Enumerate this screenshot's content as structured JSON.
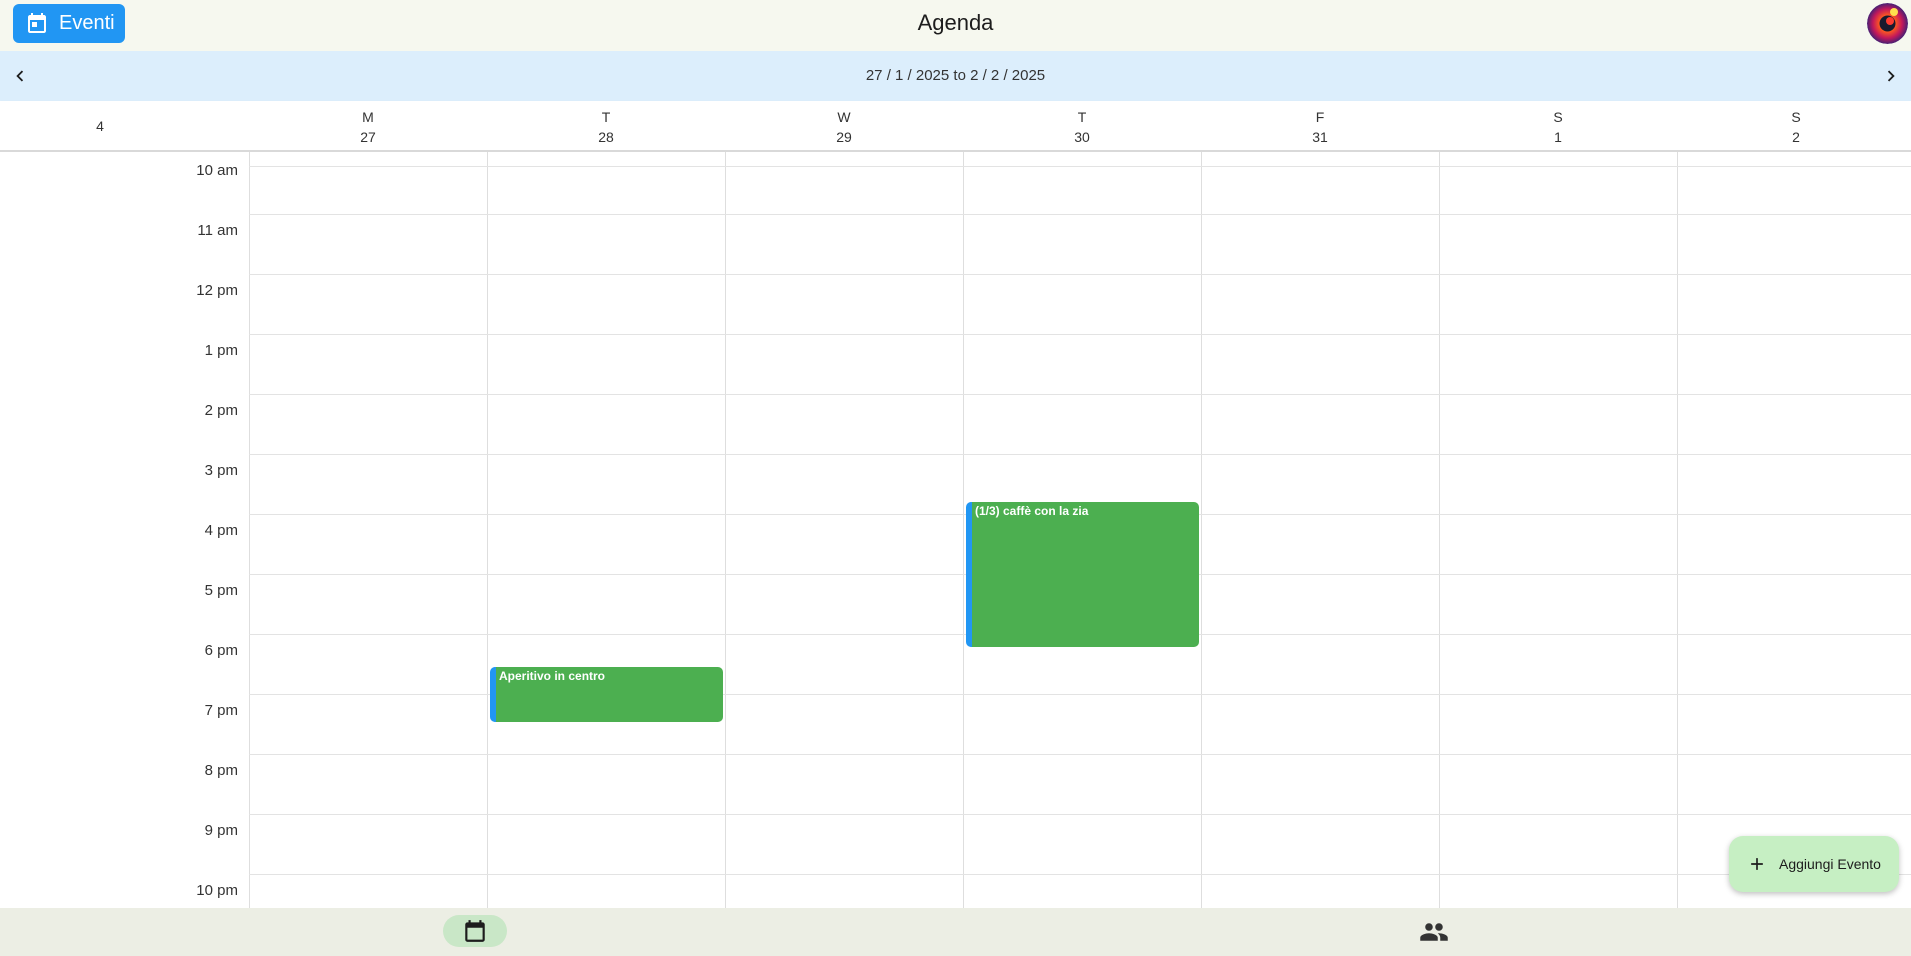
{
  "appbar": {
    "events_button_label": "Eventi",
    "title": "Agenda",
    "accent_color": "#2196f3"
  },
  "week_nav": {
    "range_text": "27 / 1 / 2025 to 2 / 2 / 2025",
    "prev_icon": "chevron-left-icon",
    "next_icon": "chevron-right-icon"
  },
  "week_number": "4",
  "days": [
    {
      "letter": "M",
      "date": "27"
    },
    {
      "letter": "T",
      "date": "28"
    },
    {
      "letter": "W",
      "date": "29"
    },
    {
      "letter": "T",
      "date": "30"
    },
    {
      "letter": "F",
      "date": "31"
    },
    {
      "letter": "S",
      "date": "1"
    },
    {
      "letter": "S",
      "date": "2"
    }
  ],
  "hours": [
    "10 am",
    "11 am",
    "12 pm",
    "1 pm",
    "2 pm",
    "3 pm",
    "4 pm",
    "5 pm",
    "6 pm",
    "7 pm",
    "8 pm",
    "9 pm",
    "10 pm"
  ],
  "events": [
    {
      "title": "Aperitivo in centro",
      "day_index": 1,
      "start": "18:15",
      "end": "19:10",
      "color": "#4caf50"
    },
    {
      "title": "(1/3) caffè con la zia",
      "day_index": 3,
      "start": "15:30",
      "end": "17:55",
      "color": "#4caf50"
    }
  ],
  "fab": {
    "label": "Aggiungi Evento",
    "icon": "plus-icon"
  },
  "bottom_nav": {
    "items": [
      {
        "icon": "calendar-icon",
        "selected": true
      },
      {
        "icon": "people-icon",
        "selected": false
      }
    ]
  }
}
